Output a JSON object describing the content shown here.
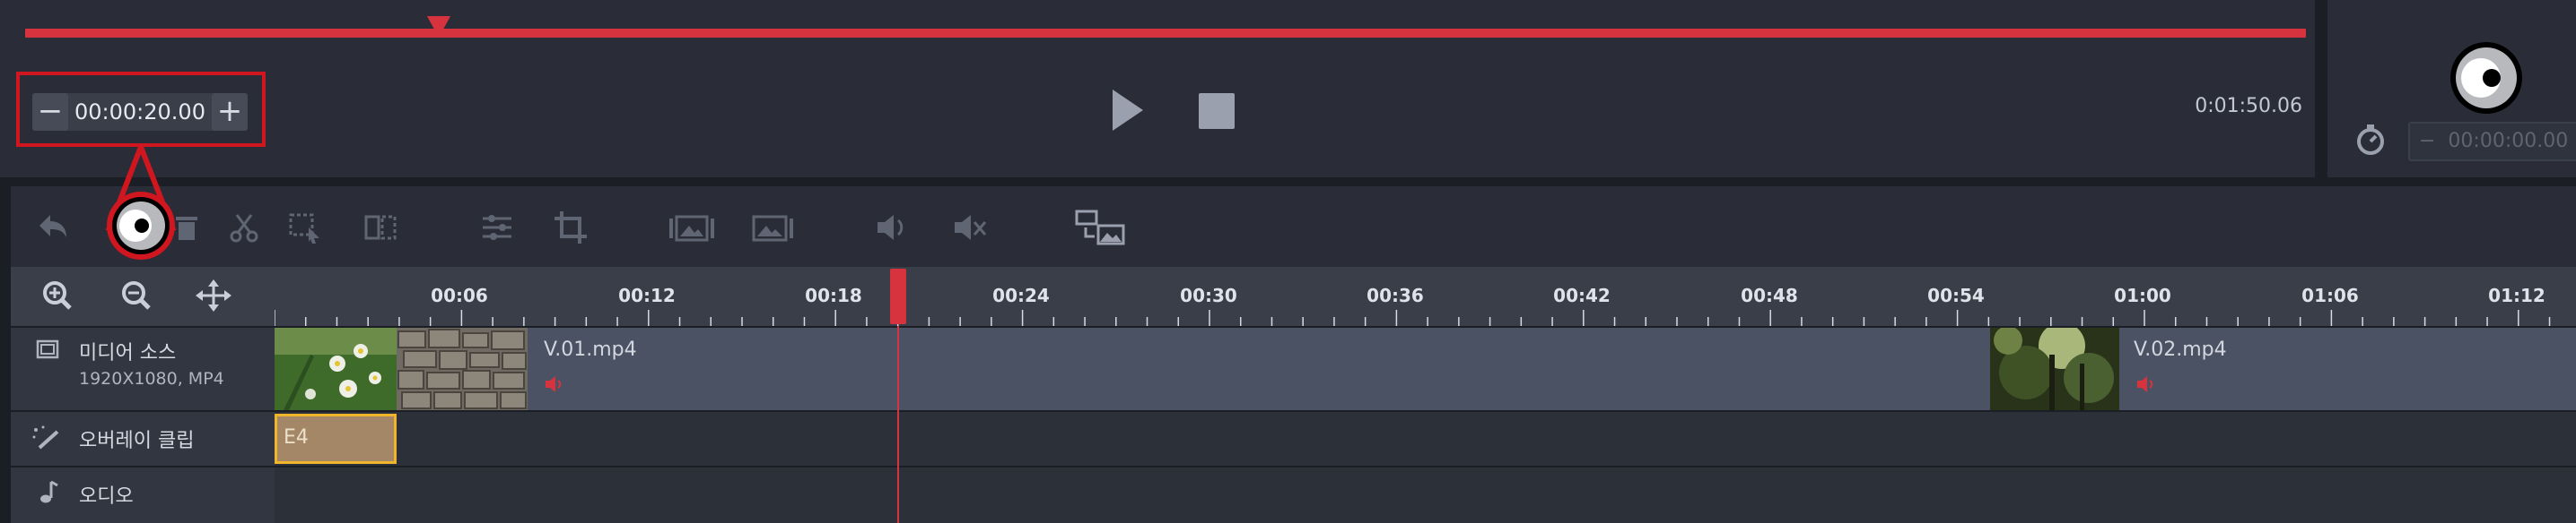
{
  "preview": {
    "time_minus": "−",
    "time_plus": "+",
    "current_time": "00:00:20.00",
    "duration": "0:01:50.06",
    "right_time": "00:00:00.00"
  },
  "ruler": {
    "ticks": [
      "00:06",
      "00:12",
      "00:18",
      "00:24",
      "00:30",
      "00:36",
      "00:42",
      "00:48",
      "00:54",
      "01:00",
      "01:06",
      "01:12"
    ]
  },
  "tracks": {
    "media": {
      "label": "미디어 소스",
      "sub": "1920X1080, MP4"
    },
    "overlay": {
      "label": "오버레이 클립"
    },
    "audio": {
      "label": "오디오"
    }
  },
  "clips": {
    "clip1_name": "V.01.mp4",
    "clip2_name": "V.02.mp4",
    "overlay_name": "E4"
  },
  "colors": {
    "accent": "#d7333f",
    "highlight": "#d0161f",
    "overlay_border": "#f0b52a"
  }
}
